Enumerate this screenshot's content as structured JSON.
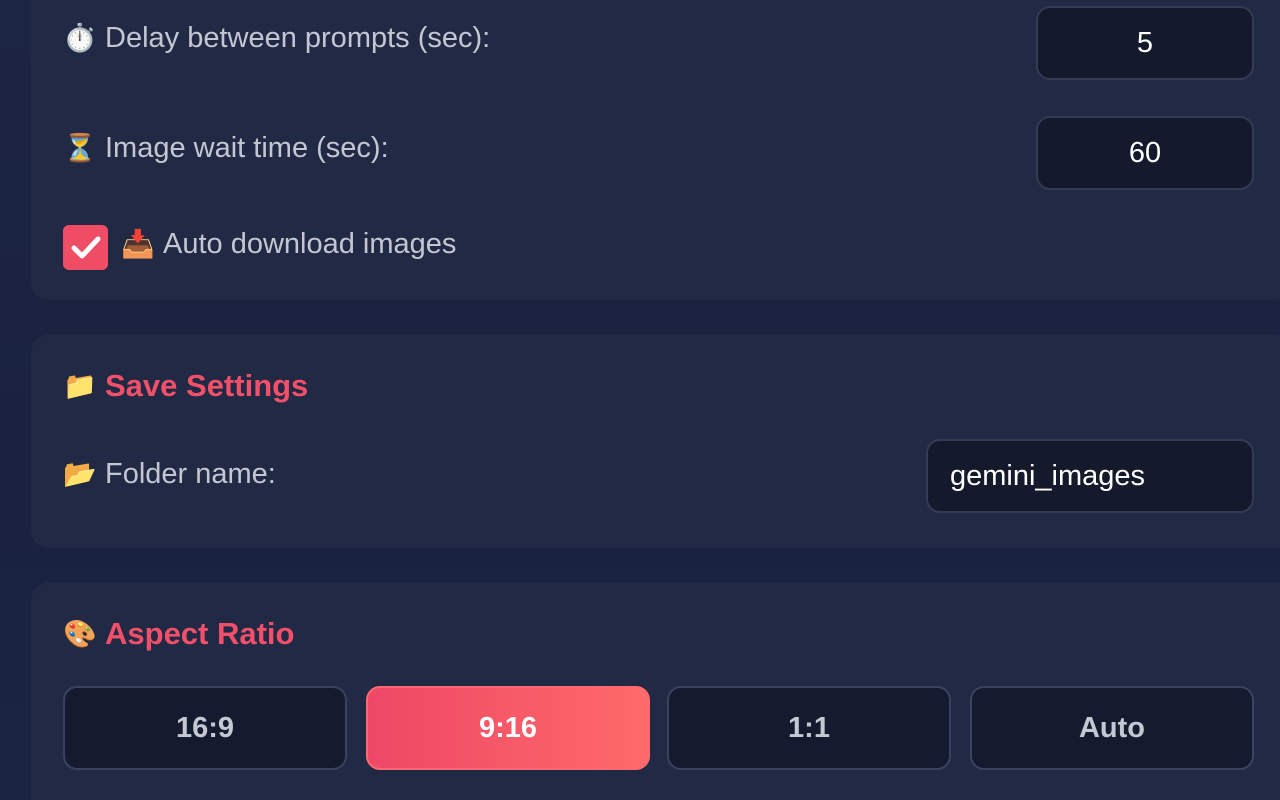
{
  "timing": {
    "delay": {
      "icon": "stopwatch-icon",
      "emoji": "⏱️",
      "label": "Delay between prompts (sec):",
      "value": "5"
    },
    "wait": {
      "icon": "hourglass-icon",
      "emoji": "⏳",
      "label": "Image wait time (sec):",
      "value": "60"
    },
    "auto_download": {
      "icon": "inbox-tray-icon",
      "emoji": "📥",
      "label": "Auto download images",
      "checked": true
    }
  },
  "save_settings": {
    "icon": "folder-icon",
    "emoji": "📁",
    "title": "Save Settings",
    "folder": {
      "icon": "open-folder-icon",
      "emoji": "📂",
      "label": "Folder name:",
      "value": "gemini_images"
    }
  },
  "aspect_ratio": {
    "icon": "palette-icon",
    "emoji": "🎨",
    "title": "Aspect Ratio",
    "options": [
      "16:9",
      "9:16",
      "1:1",
      "Auto"
    ],
    "selected": "9:16"
  },
  "colors": {
    "accent": "#f2506a",
    "active_gradient_start": "#ee4865",
    "active_gradient_end": "#ff6a6a",
    "card_bg": "#212944",
    "input_bg": "#141a2c"
  }
}
